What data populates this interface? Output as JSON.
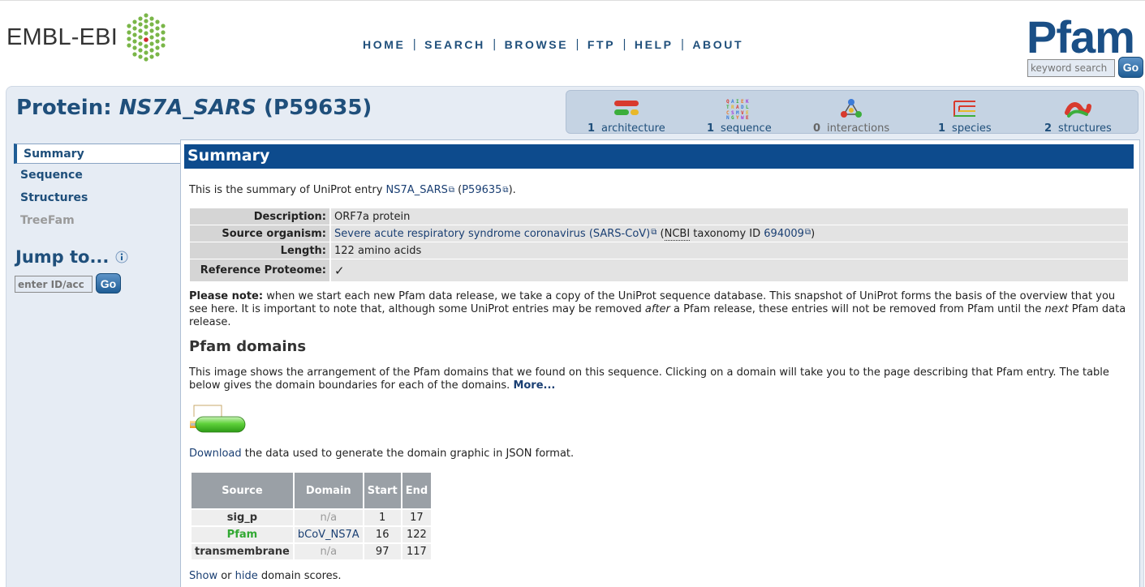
{
  "header": {
    "ebi_logo_text": "EMBL-EBI",
    "nav": [
      "HOME",
      "SEARCH",
      "BROWSE",
      "FTP",
      "HELP",
      "ABOUT"
    ],
    "nav_separator": "|",
    "pfam_logo_text": "Pfam",
    "keyword_search_placeholder": "keyword search",
    "go_label": "Go"
  },
  "page": {
    "title_prefix": "Protein: ",
    "title_id": "NS7A_SARS",
    "title_acc": " (P59635)"
  },
  "icon_bar": [
    {
      "count": "1",
      "label": "architecture",
      "icon": "architecture-icon"
    },
    {
      "count": "1",
      "label": "sequence",
      "icon": "sequence-icon"
    },
    {
      "count": "0",
      "label": "interactions",
      "icon": "interactions-icon"
    },
    {
      "count": "1",
      "label": "species",
      "icon": "species-icon"
    },
    {
      "count": "2",
      "label": "structures",
      "icon": "structures-icon"
    }
  ],
  "left_nav": {
    "items": [
      "Summary",
      "Sequence",
      "Structures",
      "TreeFam"
    ],
    "jump_title": "Jump to...",
    "jump_placeholder": "enter ID/acc",
    "go_label": "Go"
  },
  "summary": {
    "heading": "Summary",
    "intro_prefix": "This is the summary of UniProt entry ",
    "intro_entry": "NS7A_SARS",
    "intro_mid": " (",
    "intro_acc": "P59635",
    "intro_suffix": ").",
    "description_label": "Description:",
    "description_value": "ORF7a protein",
    "organism_label": "Source organism:",
    "organism_value": "Severe acute respiratory syndrome coronavirus (SARS-CoV)",
    "organism_ncbi_open": " (",
    "organism_ncbi": "NCBI",
    "organism_taxid_label": " taxonomy ID ",
    "organism_taxid": "694009",
    "organism_close": ")",
    "length_label": "Length:",
    "length_value": "122 amino acids",
    "refprot_label": "Reference Proteome:",
    "refprot_value": "✓",
    "note_bold": "Please note:",
    "note_text_1": " when we start each new Pfam data release, we take a copy of the UniProt sequence database. This snapshot of UniProt forms the basis of the overview that you see here. It is important to note that, although some UniProt entries may be removed ",
    "note_after": "after",
    "note_text_2": " a Pfam release, these entries will not be removed from Pfam until the ",
    "note_next": "next",
    "note_text_3": " Pfam data release."
  },
  "pfam_domains": {
    "heading": "Pfam domains",
    "text": "This image shows the arrangement of the Pfam domains that we found on this sequence. Clicking on a domain will take you to the page describing that Pfam entry. The table below gives the domain boundaries for each of the domains. ",
    "more_link": "More...",
    "download_link": "Download",
    "download_text": " the data used to generate the domain graphic in JSON format.",
    "table_headers": [
      "Source",
      "Domain",
      "Start",
      "End"
    ],
    "rows": [
      {
        "source": "sig_p",
        "domain": "n/a",
        "start": "1",
        "end": "17"
      },
      {
        "source": "Pfam",
        "domain": "bCoV_NS7A",
        "start": "16",
        "end": "122"
      },
      {
        "source": "transmembrane",
        "domain": "n/a",
        "start": "97",
        "end": "117"
      }
    ],
    "show_link": "Show",
    "or_text": " or ",
    "hide_link": "hide",
    "scores_text": " domain scores."
  },
  "colors": {
    "brand_blue": "#1f4f7b",
    "summary_bar": "#0d4b8d",
    "pfam_green": "#31a832"
  }
}
